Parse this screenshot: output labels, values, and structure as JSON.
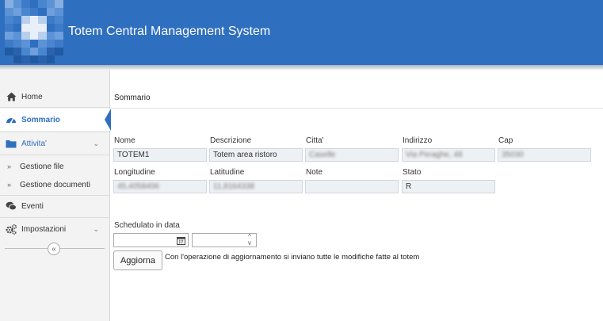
{
  "app": {
    "title": "Totem Central Management System"
  },
  "colors": {
    "header": "#2f6fbf",
    "accent": "#2f6fbf",
    "sidebar_bg": "#f3f3f3"
  },
  "sidebar": {
    "items": [
      {
        "label": "Home",
        "icon": "home-icon"
      },
      {
        "label": "Sommario",
        "icon": "dashboard-icon",
        "active": true
      },
      {
        "label": "Attivita'",
        "icon": "folder-icon",
        "expanded": true
      },
      {
        "label": "Eventi",
        "icon": "comments-icon"
      },
      {
        "label": "Impostazioni",
        "icon": "gears-icon"
      }
    ],
    "subitems": [
      {
        "label": "Gestione file"
      },
      {
        "label": "Gestione documenti"
      }
    ],
    "collapse_glyph": "«"
  },
  "breadcrumb": "Sommario",
  "form": {
    "nome": {
      "label": "Nome",
      "value": "TOTEM1"
    },
    "descrizione": {
      "label": "Descrizione",
      "value": "Totem area ristoro"
    },
    "citta": {
      "label": "Citta'",
      "value": "Caselle"
    },
    "indirizzo": {
      "label": "Indirizzo",
      "value": "Via Peraghe, 48"
    },
    "cap": {
      "label": "Cap",
      "value": "35030"
    },
    "longitudine": {
      "label": "Longitudine",
      "value": "45,4058406"
    },
    "latitudine": {
      "label": "Latitudine",
      "value": "11,8164338"
    },
    "note": {
      "label": "Note",
      "value": ""
    },
    "stato": {
      "label": "Stato",
      "value": "R"
    }
  },
  "schedule": {
    "label": "Schedulato in data",
    "date_value": "",
    "time_value": "",
    "calendar_icon": "calendar-icon",
    "spinner_up": "^",
    "spinner_down": "v"
  },
  "actions": {
    "update_label": "Aggiorna",
    "update_note": "Con l'operazione di aggiornamento si inviano tutte le modifiche fatte al totem"
  }
}
